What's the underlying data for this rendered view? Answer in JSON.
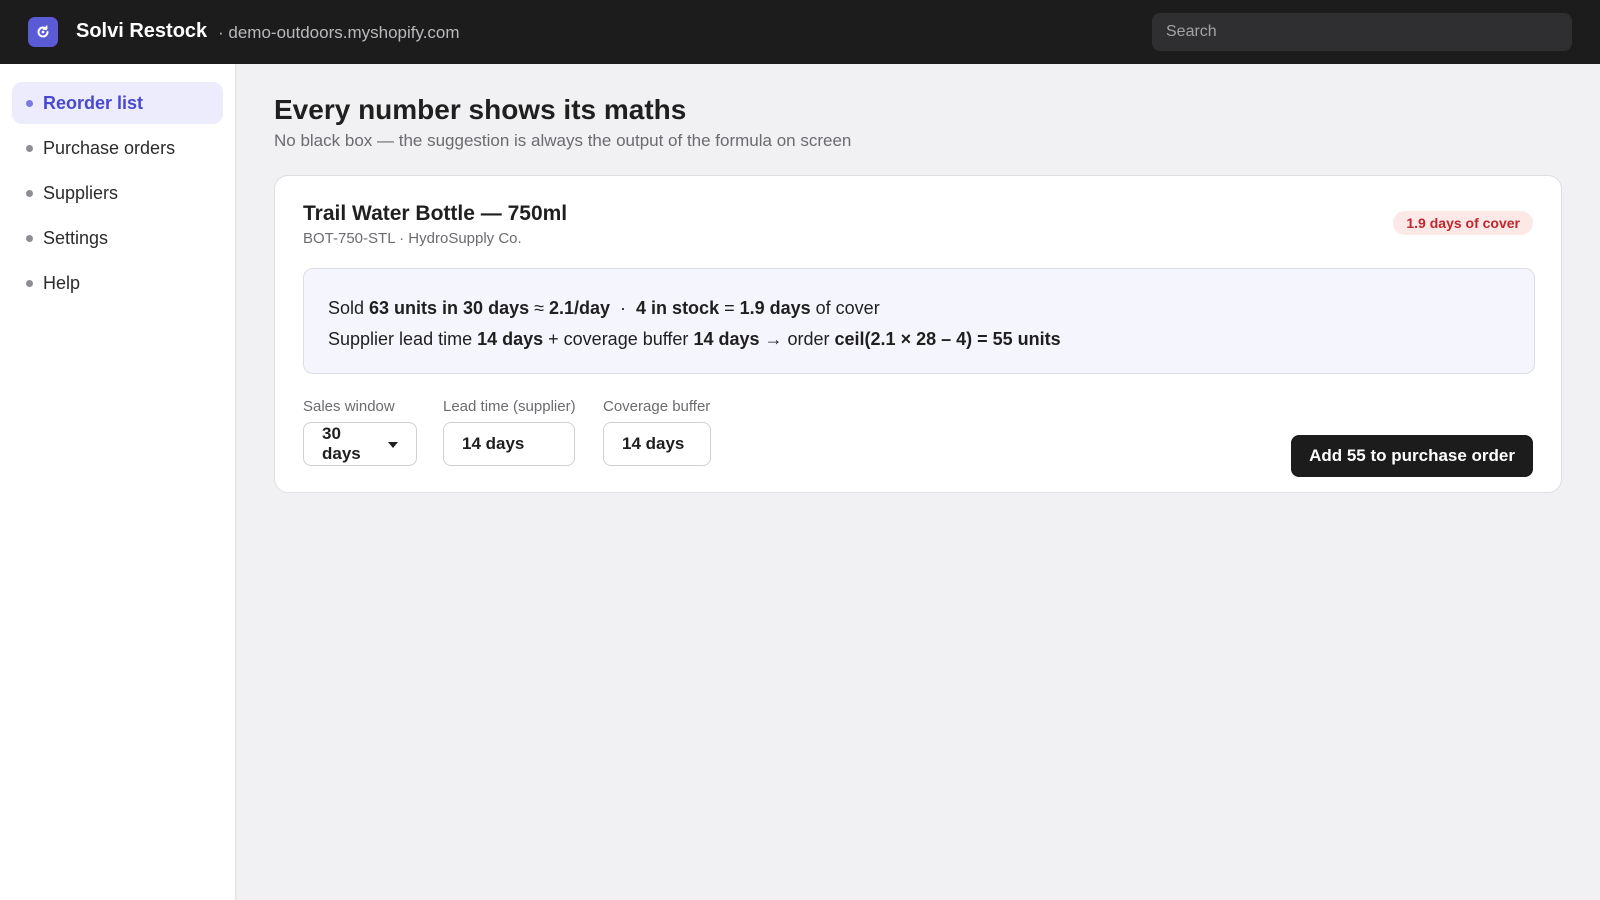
{
  "topbar": {
    "app_name": "Solvi Restock",
    "store_url": "· demo-outdoors.myshopify.com",
    "search_placeholder": "Search",
    "logo_icon": "refresh-icon",
    "brand_color": "#5b5bd6"
  },
  "sidebar": {
    "items": [
      {
        "label": "Reorder list",
        "active": true
      },
      {
        "label": "Purchase orders",
        "active": false
      },
      {
        "label": "Suppliers",
        "active": false
      },
      {
        "label": "Settings",
        "active": false
      },
      {
        "label": "Help",
        "active": false
      }
    ]
  },
  "main": {
    "title": "Every number shows its maths",
    "subtitle": "No black box — the suggestion is always the output of the formula on screen",
    "product": {
      "name": "Trail Water Bottle — 750ml",
      "meta": "BOT-750-STL · HydroSupply Co.",
      "cover_badge": "1.9 days of cover",
      "cover_badge_color": "#c0262d",
      "formula_line1": {
        "t1": "Sold ",
        "b1": "63 units in 30 days",
        "t2": " ≈ ",
        "b2": "2.1/day",
        "t3": "  ·  ",
        "b3": "4 in stock",
        "t4": " = ",
        "b4": "1.9 days",
        "t5": " of cover"
      },
      "formula_line2": {
        "t1": "Supplier lead time ",
        "b1": "14 days",
        "t2": " + coverage buffer ",
        "b2": "14 days",
        "t3": " → order ",
        "b3": "ceil(2.1 × 28 – 4) = 55 units"
      },
      "fields": {
        "sales_window": {
          "label": "Sales window",
          "value": "30 days"
        },
        "lead_time": {
          "label": "Lead time (supplier)",
          "value": "14 days"
        },
        "coverage_buffer": {
          "label": "Coverage buffer",
          "value": "14 days"
        }
      },
      "primary_action": "Add 55 to purchase order"
    }
  }
}
